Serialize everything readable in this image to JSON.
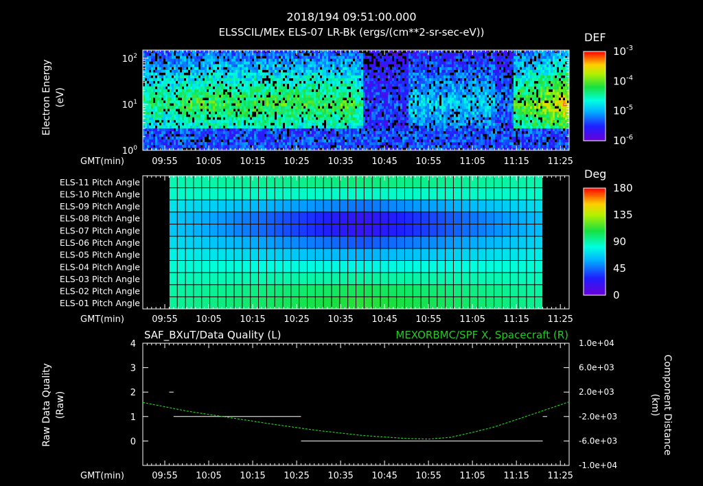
{
  "header": {
    "line1": "2018/194  09:51:00.000",
    "line2": "ELSSCIL/MEx ELS-07 LR-Bk   (ergs/(cm**2-sr-sec-eV))"
  },
  "time_axis": {
    "label": "GMT(min)",
    "ticks": [
      "09:55",
      "10:05",
      "10:15",
      "10:25",
      "10:35",
      "10:45",
      "10:55",
      "11:05",
      "11:15",
      "11:25"
    ]
  },
  "colors": {
    "background": "#000000",
    "axes": "#ffffff",
    "right_series": "#22cc22",
    "left_series": "#ffffff"
  },
  "chart_data": [
    {
      "type": "heatmap",
      "title": "ELSSCIL/MEx ELS-07 LR-Bk",
      "ylabel_line1": "Electron Energy",
      "ylabel_line2": "(eV)",
      "y_tick_labels": [
        {
          "b": "10",
          "e": "0",
          "value": 1
        },
        {
          "b": "10",
          "e": "1",
          "value": 10
        },
        {
          "b": "10",
          "e": "2",
          "value": 100
        }
      ],
      "y_scale": "log",
      "ylim": [
        1,
        150
      ],
      "colorbar": {
        "title": "DEF",
        "labels": [
          {
            "b": "10",
            "e": "-3",
            "value": 0.001
          },
          {
            "b": "10",
            "e": "-4",
            "value": 0.0001
          },
          {
            "b": "10",
            "e": "-5",
            "value": 1e-05
          },
          {
            "b": "10",
            "e": "-6",
            "value": 1e-06
          }
        ]
      },
      "xlim": [
        "09:50",
        "11:27"
      ]
    },
    {
      "type": "heatmap",
      "rows": [
        "ELS-11 Pitch Angle",
        "ELS-10 Pitch Angle",
        "ELS-09 Pitch Angle",
        "ELS-08 Pitch Angle",
        "ELS-07 Pitch Angle",
        "ELS-06 Pitch Angle",
        "ELS-05 Pitch Angle",
        "ELS-04 Pitch Angle",
        "ELS-03 Pitch Angle",
        "ELS-02 Pitch Angle",
        "ELS-01 Pitch Angle"
      ],
      "data_range": [
        "09:56",
        "11:21"
      ],
      "colorbar": {
        "title": "Deg",
        "labels": [
          "180",
          "135",
          "90",
          "45",
          "0"
        ],
        "range": [
          0,
          180
        ]
      },
      "approx_values_deg": {
        "ELS-11 Pitch Angle": 95,
        "ELS-10 Pitch Angle": 85,
        "ELS-09 Pitch Angle": 55,
        "ELS-08 Pitch Angle": 35,
        "ELS-07 Pitch Angle": 35,
        "ELS-06 Pitch Angle": 50,
        "ELS-05 Pitch Angle": 65,
        "ELS-04 Pitch Angle": 80,
        "ELS-03 Pitch Angle": 90,
        "ELS-02 Pitch Angle": 100,
        "ELS-01 Pitch Angle": 105
      },
      "xlim": [
        "09:50",
        "11:27"
      ]
    },
    {
      "type": "line",
      "left_title": "SAF_BXuT/Data Quality (L)",
      "right_title": "MEXORBMC/SPF X, Spacecraft (R)",
      "ylabel_left_line1": "Raw Data Quality",
      "ylabel_left_line2": "(Raw)",
      "ylabel_right_line1": "Component Distance",
      "ylabel_right_line2": "(km)",
      "y_left_ticks": [
        "4",
        "3",
        "2",
        "1",
        "0"
      ],
      "ylim_left": [
        -1,
        4
      ],
      "y_right_ticks": [
        "1.0e+04",
        "6.0e+03",
        "2.0e+03",
        "-2.0e+03",
        "-6.0e+03",
        "-1.0e+04"
      ],
      "ylim_right": [
        -10000,
        10000
      ],
      "xlim": [
        "09:50",
        "11:27"
      ],
      "series": [
        {
          "name": "SAF_BXuT/Data Quality",
          "axis": "left",
          "segments": [
            {
              "x": [
                "09:56",
                "09:57"
              ],
              "y": [
                2,
                2
              ]
            },
            {
              "x": [
                "09:57",
                "10:26"
              ],
              "y": [
                1,
                1
              ]
            },
            {
              "x": [
                "10:26",
                "11:21"
              ],
              "y": [
                0,
                0
              ]
            },
            {
              "x": [
                "11:21",
                "11:22"
              ],
              "y": [
                1,
                1
              ]
            }
          ]
        },
        {
          "name": "MEXORBMC/SPF X, Spacecraft",
          "axis": "right",
          "x": [
            "09:50",
            "10:00",
            "10:10",
            "10:20",
            "10:30",
            "10:40",
            "10:50",
            "10:55",
            "11:00",
            "11:05",
            "11:10",
            "11:15",
            "11:20",
            "11:27"
          ],
          "y": [
            300,
            -1100,
            -2200,
            -3300,
            -4300,
            -5100,
            -5600,
            -5700,
            -5400,
            -4600,
            -3700,
            -2500,
            -1300,
            400
          ]
        }
      ]
    }
  ]
}
